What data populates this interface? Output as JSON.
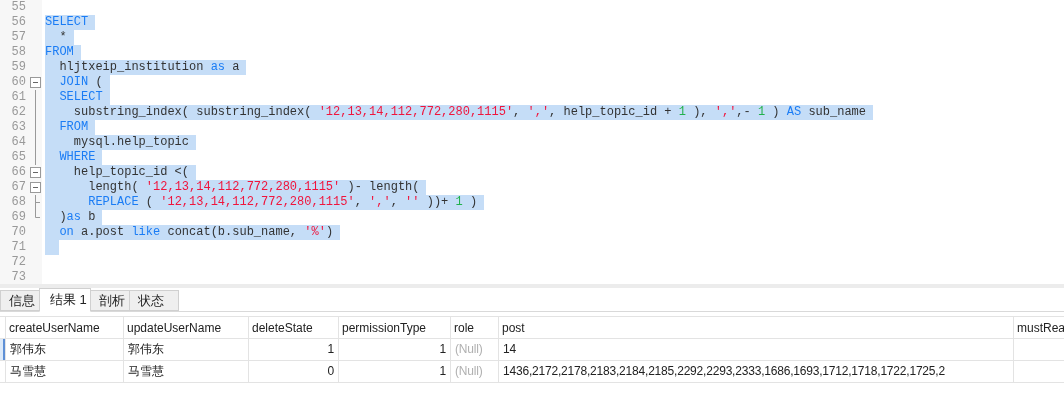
{
  "editor": {
    "lines": [
      {
        "number": "55",
        "selected": false,
        "kind": "plain"
      },
      {
        "number": "56",
        "selected": true,
        "kind": "plain",
        "tokens": [
          {
            "kind": "keyword",
            "text": "SELECT"
          }
        ]
      },
      {
        "number": "57",
        "selected": true,
        "kind": "plain",
        "tokens": [
          {
            "kind": "plain",
            "text": "  *"
          }
        ]
      },
      {
        "number": "58",
        "selected": true,
        "kind": "plain",
        "tokens": [
          {
            "kind": "keyword",
            "text": "FROM"
          }
        ]
      },
      {
        "number": "59",
        "selected": true,
        "kind": "plain",
        "tokens": [
          {
            "kind": "plain",
            "text": "  hljtxeip_institution "
          },
          {
            "kind": "keyword",
            "text": "as"
          },
          {
            "kind": "plain",
            "text": " a"
          }
        ]
      },
      {
        "number": "60",
        "selected": true,
        "kind": "fold-start",
        "tokens": [
          {
            "kind": "keyword",
            "text": "  JOIN"
          },
          {
            "kind": "plain",
            "text": " ("
          }
        ]
      },
      {
        "number": "61",
        "selected": true,
        "kind": "fold-inner",
        "tokens": [
          {
            "kind": "keyword",
            "text": "  SELECT"
          }
        ]
      },
      {
        "number": "62",
        "selected": true,
        "kind": "fold-inner",
        "tokens": [
          {
            "kind": "plain",
            "text": "    substring_index( substring_index( "
          },
          {
            "kind": "string",
            "text": "'12,13,14,112,772,280,1115'"
          },
          {
            "kind": "plain",
            "text": ", "
          },
          {
            "kind": "string",
            "text": "','"
          },
          {
            "kind": "plain",
            "text": ", help_topic_id + "
          },
          {
            "kind": "number",
            "text": "1"
          },
          {
            "kind": "plain",
            "text": " ), "
          },
          {
            "kind": "string",
            "text": "','"
          },
          {
            "kind": "plain",
            "text": ",- "
          },
          {
            "kind": "number",
            "text": "1"
          },
          {
            "kind": "plain",
            "text": " ) "
          },
          {
            "kind": "keyword",
            "text": "AS"
          },
          {
            "kind": "plain",
            "text": " sub_name"
          }
        ]
      },
      {
        "number": "63",
        "selected": true,
        "kind": "fold-inner",
        "tokens": [
          {
            "kind": "keyword",
            "text": "  FROM"
          }
        ]
      },
      {
        "number": "64",
        "selected": true,
        "kind": "fold-inner",
        "tokens": [
          {
            "kind": "plain",
            "text": "    mysql.help_topic"
          }
        ]
      },
      {
        "number": "65",
        "selected": true,
        "kind": "fold-inner",
        "tokens": [
          {
            "kind": "keyword",
            "text": "  WHERE"
          }
        ]
      },
      {
        "number": "66",
        "selected": true,
        "kind": "fold-start",
        "tokens": [
          {
            "kind": "plain",
            "text": "    help_topic_id <("
          }
        ]
      },
      {
        "number": "67",
        "selected": true,
        "kind": "fold-start",
        "tokens": [
          {
            "kind": "plain",
            "text": "      length( "
          },
          {
            "kind": "string",
            "text": "'12,13,14,112,772,280,1115'"
          },
          {
            "kind": "plain",
            "text": " )- length("
          }
        ]
      },
      {
        "number": "68",
        "selected": true,
        "kind": "fold-branch-end",
        "tokens": [
          {
            "kind": "keyword",
            "text": "      REPLACE"
          },
          {
            "kind": "plain",
            "text": " ( "
          },
          {
            "kind": "string",
            "text": "'12,13,14,112,772,280,1115'"
          },
          {
            "kind": "plain",
            "text": ", "
          },
          {
            "kind": "string",
            "text": "','"
          },
          {
            "kind": "plain",
            "text": ", "
          },
          {
            "kind": "string",
            "text": "''"
          },
          {
            "kind": "plain",
            "text": " ))+ "
          },
          {
            "kind": "number",
            "text": "1"
          },
          {
            "kind": "plain",
            "text": " )"
          }
        ]
      },
      {
        "number": "69",
        "selected": true,
        "kind": "fold-end",
        "tokens": [
          {
            "kind": "plain",
            "text": "  )"
          },
          {
            "kind": "keyword",
            "text": "as"
          },
          {
            "kind": "plain",
            "text": " b"
          }
        ]
      },
      {
        "number": "70",
        "selected": true,
        "kind": "plain",
        "tokens": [
          {
            "kind": "keyword",
            "text": "  on"
          },
          {
            "kind": "plain",
            "text": " a.post "
          },
          {
            "kind": "keyword",
            "text": "like"
          },
          {
            "kind": "plain",
            "text": " concat(b.sub_name, "
          },
          {
            "kind": "string",
            "text": "'%'"
          },
          {
            "kind": "plain",
            "text": ")"
          }
        ]
      },
      {
        "number": "71",
        "selected": true,
        "kind": "plain"
      },
      {
        "number": "72",
        "selected": false,
        "kind": "plain"
      },
      {
        "number": "73",
        "selected": false,
        "kind": "plain"
      }
    ]
  },
  "tabs": [
    {
      "label": "信息",
      "selected": false
    },
    {
      "label": "结果 1",
      "selected": true
    },
    {
      "label": "剖析",
      "selected": false
    },
    {
      "label": "状态",
      "selected": false
    }
  ],
  "table": {
    "columns": [
      "createUserName",
      "updateUserName",
      "deleteState",
      "permissionType",
      "role",
      "post",
      "mustRea"
    ],
    "rows": [
      {
        "selected": true,
        "cells": [
          {
            "kind": "text",
            "text": "郭伟东"
          },
          {
            "kind": "text",
            "text": "郭伟东"
          },
          {
            "kind": "number",
            "text": "1"
          },
          {
            "kind": "number",
            "text": "1"
          },
          {
            "kind": "null",
            "text": "(Null)"
          },
          {
            "kind": "text",
            "text": "14"
          },
          {
            "kind": "empty"
          }
        ]
      },
      {
        "selected": false,
        "cells": [
          {
            "kind": "text",
            "text": "马雪慧"
          },
          {
            "kind": "text",
            "text": "马雪慧"
          },
          {
            "kind": "number",
            "text": "0"
          },
          {
            "kind": "number",
            "text": "1"
          },
          {
            "kind": "null",
            "text": "(Null)"
          },
          {
            "kind": "text",
            "text": "1436,2172,2178,2183,2184,2185,2292,2293,2333,1686,1693,1712,1718,1722,1725,2"
          },
          {
            "kind": "empty"
          }
        ]
      }
    ]
  }
}
